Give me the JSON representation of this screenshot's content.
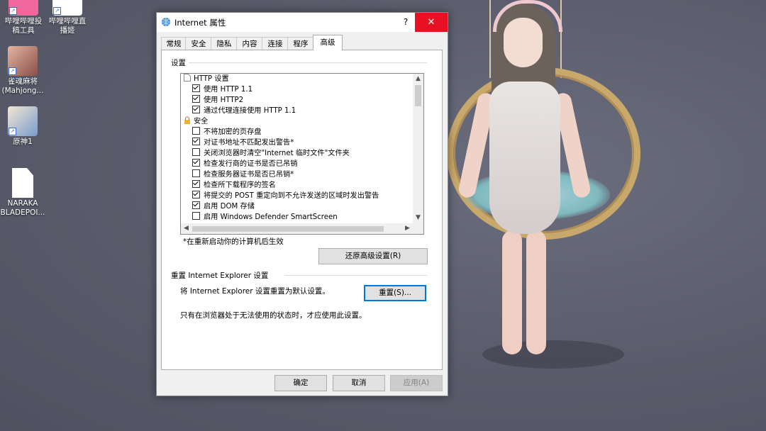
{
  "desktop": {
    "icons": [
      {
        "label_line1": "哔哩哔哩投",
        "label_line2": "稿工具",
        "badge": "bilibili"
      },
      {
        "label_line1": "哔哩哔哩直",
        "label_line2": "播姬"
      },
      {
        "label_line1": "雀魂麻将",
        "label_line2": "(Mahjong..."
      },
      {
        "label_line1": "原神1",
        "label_line2": ""
      },
      {
        "label_line1": "NARAKA",
        "label_line2": "BLADEPOI..."
      }
    ]
  },
  "dialog": {
    "title": "Internet 属性",
    "help_label": "?",
    "close_label": "✕",
    "tabs": [
      "常规",
      "安全",
      "隐私",
      "内容",
      "连接",
      "程序",
      "高级"
    ],
    "active_tab": "高级",
    "settings_group_label": "设置",
    "settings_list": [
      {
        "type": "category",
        "icon": "page-icon",
        "label": "HTTP 设置"
      },
      {
        "type": "checkbox",
        "checked": true,
        "label": "使用 HTTP 1.1"
      },
      {
        "type": "checkbox",
        "checked": true,
        "label": "使用 HTTP2"
      },
      {
        "type": "checkbox",
        "checked": true,
        "label": "通过代理连接使用 HTTP 1.1"
      },
      {
        "type": "category",
        "icon": "lock-icon",
        "label": "安全"
      },
      {
        "type": "checkbox",
        "checked": false,
        "label": "不将加密的页存盘"
      },
      {
        "type": "checkbox",
        "checked": true,
        "label": "对证书地址不匹配发出警告*"
      },
      {
        "type": "checkbox",
        "checked": false,
        "label": "关闭浏览器时清空\"Internet 临时文件\"文件夹"
      },
      {
        "type": "checkbox",
        "checked": true,
        "label": "检查发行商的证书是否已吊销"
      },
      {
        "type": "checkbox",
        "checked": false,
        "label": "检查服务器证书是否已吊销*"
      },
      {
        "type": "checkbox",
        "checked": true,
        "label": "检查所下载程序的签名"
      },
      {
        "type": "checkbox",
        "checked": true,
        "label": "将提交的 POST 重定向到不允许发送的区域时发出警告"
      },
      {
        "type": "checkbox",
        "checked": true,
        "label": "启用 DOM 存储"
      },
      {
        "type": "checkbox",
        "checked": false,
        "label": "启用 Windows Defender SmartScreen"
      }
    ],
    "restart_note": "*在重新启动你的计算机后生效",
    "restore_advanced_button": "还原高级设置(R)",
    "reset_group_label": "重置 Internet Explorer 设置",
    "reset_description": "将 Internet Explorer 设置重置为默认设置。",
    "reset_button": "重置(S)...",
    "reset_warning": "只有在浏览器处于无法使用的状态时，才应使用此设置。",
    "ok_button": "确定",
    "cancel_button": "取消",
    "apply_button": "应用(A)"
  },
  "colors": {
    "close_button": "#e81123",
    "focus_border": "#0078d7",
    "desktop_bg": "#5b5e6e"
  }
}
